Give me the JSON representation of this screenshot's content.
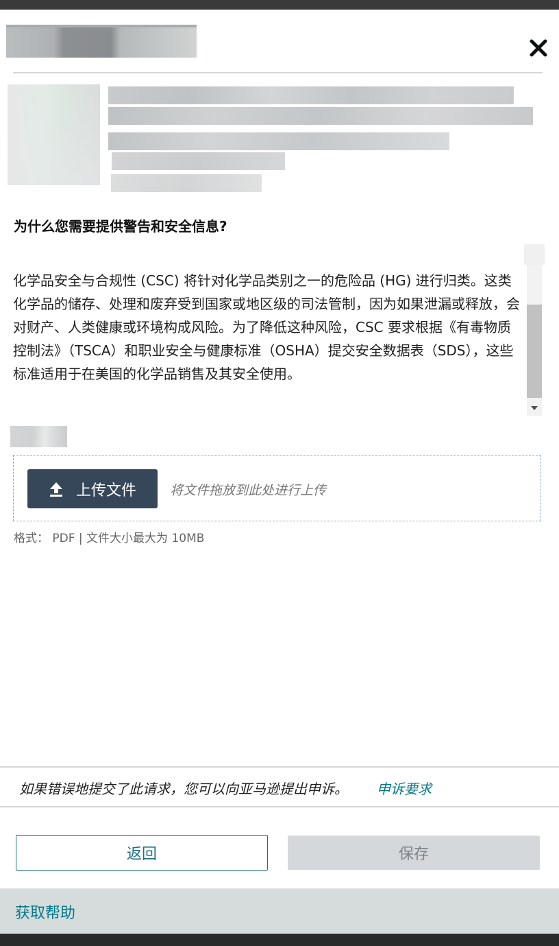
{
  "header": {
    "close_icon": "close-icon"
  },
  "info": {
    "heading": "为什么您需要提供警告和安全信息?",
    "body": "化学品安全与合规性 (CSC) 将针对化学品类别之一的危险品 (HG) 进行归类。这类化学品的储存、处理和废弃受到国家或地区级的司法管制，因为如果泄漏或释放，会对财产、人类健康或环境构成风险。为了降低这种风险，CSC 要求根据《有毒物质控制法》（TSCA）和职业安全与健康标准（OSHA）提交安全数据表（SDS），这些标准适用于在美国的化学品销售及其安全使用。"
  },
  "upload": {
    "button_label": "上传文件",
    "icon": "upload-icon",
    "drop_hint": "将文件拖放到此处进行上传",
    "format_note": "格式： PDF | 文件大小最大为 10MB"
  },
  "appeal": {
    "text": "如果错误地提交了此请求，您可以向亚马逊提出申诉。",
    "link": "申诉要求"
  },
  "actions": {
    "back_label": "返回",
    "save_label": "保存"
  },
  "help": {
    "label": "获取帮助"
  },
  "colors": {
    "accent": "#00798a",
    "button_dark": "#37475a",
    "disabled": "#d5d8db"
  }
}
